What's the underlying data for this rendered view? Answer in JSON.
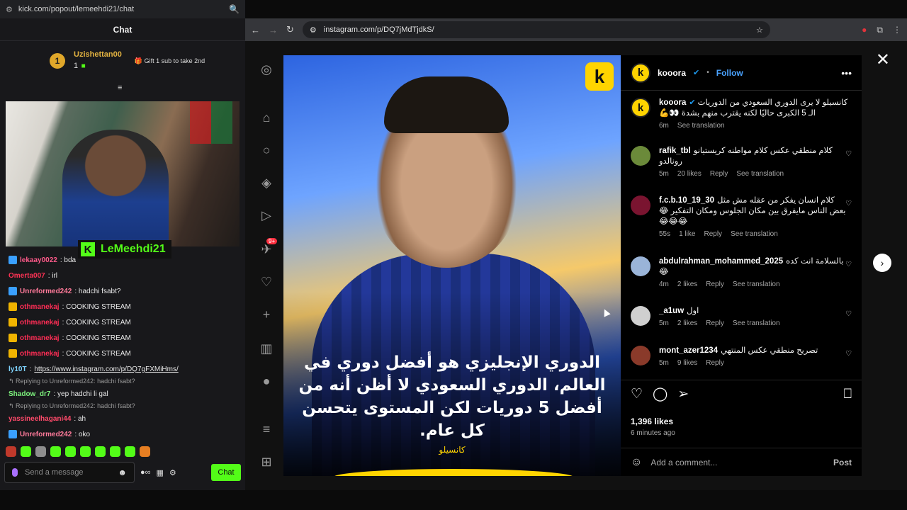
{
  "left": {
    "url": "kick.com/popout/lemeehdi21/chat",
    "chat_title": "Chat",
    "pinned": {
      "rank": "1",
      "username": "Uzishettan00",
      "sub_count": "1",
      "gift_text": "Gift 1 sub to take 2nd"
    },
    "streamer_name": "LeMeehdi21",
    "messages": [
      {
        "type": "msg",
        "badge": "blue",
        "user": "lekaay0022",
        "user_color": "#ff5a8a",
        "text": ": bda "
      },
      {
        "type": "msg",
        "badge": "",
        "user": "Omerta007",
        "user_color": "#ff3355",
        "text": ": irl"
      },
      {
        "type": "msg",
        "badge": "blue",
        "user": "Unreformed242",
        "user_color": "#ff7a9a",
        "text": ": hadchi fsabt?"
      },
      {
        "type": "msg",
        "badge": "crown",
        "user": "othmanekaj",
        "user_color": "#ff2d55",
        "text": ": COOKING STREAM"
      },
      {
        "type": "msg",
        "badge": "crown",
        "user": "othmanekaj",
        "user_color": "#ff2d55",
        "text": ": COOKING STREAM"
      },
      {
        "type": "msg",
        "badge": "crown",
        "user": "othmanekaj",
        "user_color": "#ff2d55",
        "text": ": COOKING STREAM"
      },
      {
        "type": "msg",
        "badge": "crown",
        "user": "othmanekaj",
        "user_color": "#ff2d55",
        "text": ": COOKING STREAM"
      },
      {
        "type": "link",
        "badge": "",
        "user": "ly10T",
        "user_color": "#7fd4ff",
        "text": ": ",
        "link": "https://www.instagram.com/p/DQ7gFXMiHms/"
      },
      {
        "type": "reply",
        "text": "↰ Replying to Unreformed242: hadchi fsabt?"
      },
      {
        "type": "msg",
        "badge": "",
        "user": "Shadow_dr7",
        "user_color": "#7cf07c",
        "text": ": yep hadchi li gal"
      },
      {
        "type": "reply",
        "text": "↰ Replying to Unreformed242: hadchi fsabt?"
      },
      {
        "type": "msg",
        "badge": "",
        "user": "yassineelhagani44",
        "user_color": "#ff4a6a",
        "text": ": ah"
      },
      {
        "type": "msg",
        "badge": "blue",
        "user": "Unreformed242",
        "user_color": "#ff7a9a",
        "text": ": oko"
      }
    ],
    "send_placeholder": "Send a message",
    "chat_button": "Chat"
  },
  "browser": {
    "url": "instagram.com/p/DQ7jMdTjdkS/"
  },
  "post": {
    "account": "kooora",
    "follow": "Follow",
    "caption_overlay": "الدوري الإنجليزي هو أفضل دوري في العالم، الدوري السعودي لا أظن أنه من أفضل 5 دوريات لكن المستوى يتحسن كل عام.",
    "credit": "كانسيلو",
    "caption_user": "kooora",
    "caption_text": "كانسيلو لا يرى الدوري السعودي من الدوريات الـ 5 الكبرى حاليًا لكنه يقترب منهم بشدة 👀💪",
    "caption_time": "6m",
    "see_translation": "See translation",
    "comments": [
      {
        "user": "rafik_tbl",
        "text": "كلام منطقي عكس كلام مواطنه كريستيانو رونالدو",
        "time": "5m",
        "likes": "20 likes",
        "reply": "Reply",
        "translate": "See translation",
        "avatar_color": "#6b8a3a"
      },
      {
        "user": "f.c.b.10_19_30",
        "text": "كلام انسان يفكر من عقله مش مثل بعض الناس مايفرق بين مكان الجلوس ومكان التفكير 😂😂😂😂",
        "time": "55s",
        "likes": "1 like",
        "reply": "Reply",
        "translate": "See translation",
        "avatar_color": "#7a1430"
      },
      {
        "user": "abdulrahman_mohammed_2025",
        "text": "بالسلامة انت كده 😂",
        "time": "4m",
        "likes": "2 likes",
        "reply": "Reply",
        "translate": "See translation",
        "avatar_color": "#9ab4d8"
      },
      {
        "user": "_a1uw",
        "text": "اول",
        "time": "5m",
        "likes": "2 likes",
        "reply": "Reply",
        "translate": "See translation",
        "avatar_color": "#cfcfcf"
      },
      {
        "user": "mont_azer1234",
        "text": "تصريح منطقي عكس المنتهي",
        "time": "5m",
        "likes": "9 likes",
        "reply": "Reply",
        "translate": "",
        "avatar_color": "#8a3a2a"
      }
    ],
    "likes": "1,396 likes",
    "ago": "6 minutes ago",
    "add_comment": "Add a comment...",
    "post_btn": "Post"
  }
}
